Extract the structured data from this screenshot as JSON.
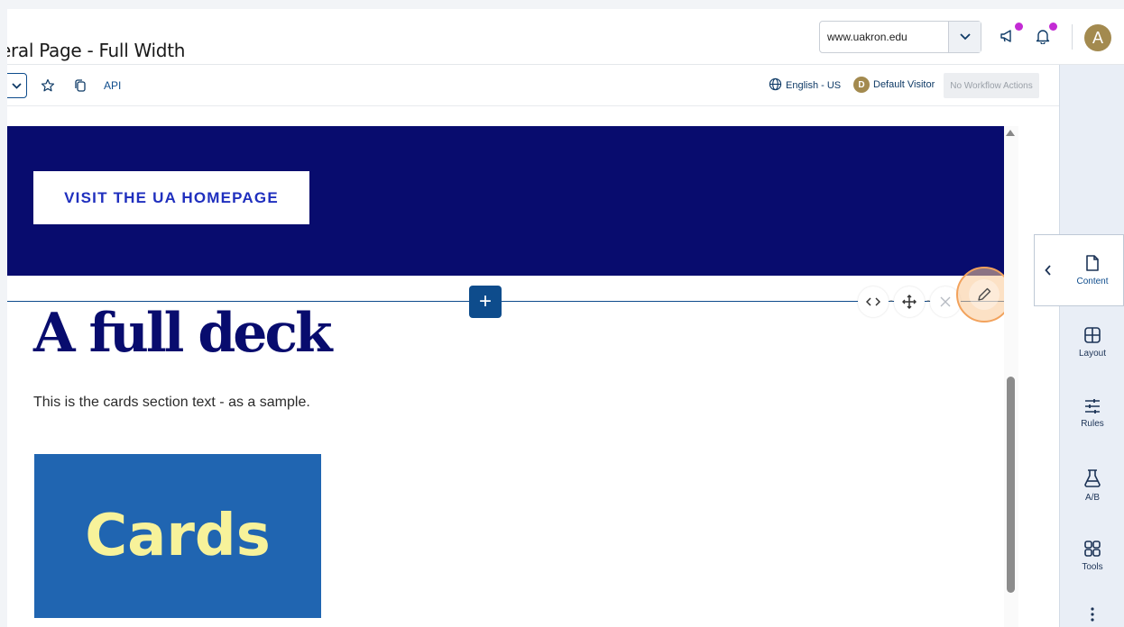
{
  "header": {
    "page_title": "eral Page - Full Width",
    "site_select_value": "www.uakron.edu",
    "avatar_initial": "A"
  },
  "toolbar": {
    "api_label": "API",
    "language_label": "English - US",
    "visitor_initial": "D",
    "visitor_label": "Default Visitor",
    "workflow_label": "No Workflow Actions"
  },
  "canvas": {
    "hero_button_label": "VISIT THE UA HOMEPAGE",
    "add_label": "+",
    "heading": "A full deck",
    "body_text": "This is the cards section text - as a sample.",
    "card_image_text": "Cards"
  },
  "rail": {
    "items": [
      {
        "label": "Content",
        "icon": "document-icon"
      },
      {
        "label": "Layout",
        "icon": "layout-grid-icon"
      },
      {
        "label": "Rules",
        "icon": "sliders-icon"
      },
      {
        "label": "A/B",
        "icon": "flask-icon"
      },
      {
        "label": "Tools",
        "icon": "tools-grid-icon"
      }
    ]
  },
  "colors": {
    "brand_navy": "#080c6e",
    "accent_blue": "#0e4c8c",
    "card_blue": "#2065b1",
    "card_text": "#f7f29a",
    "notification_dot": "#c32bd4",
    "highlight": "#f2a25c"
  }
}
